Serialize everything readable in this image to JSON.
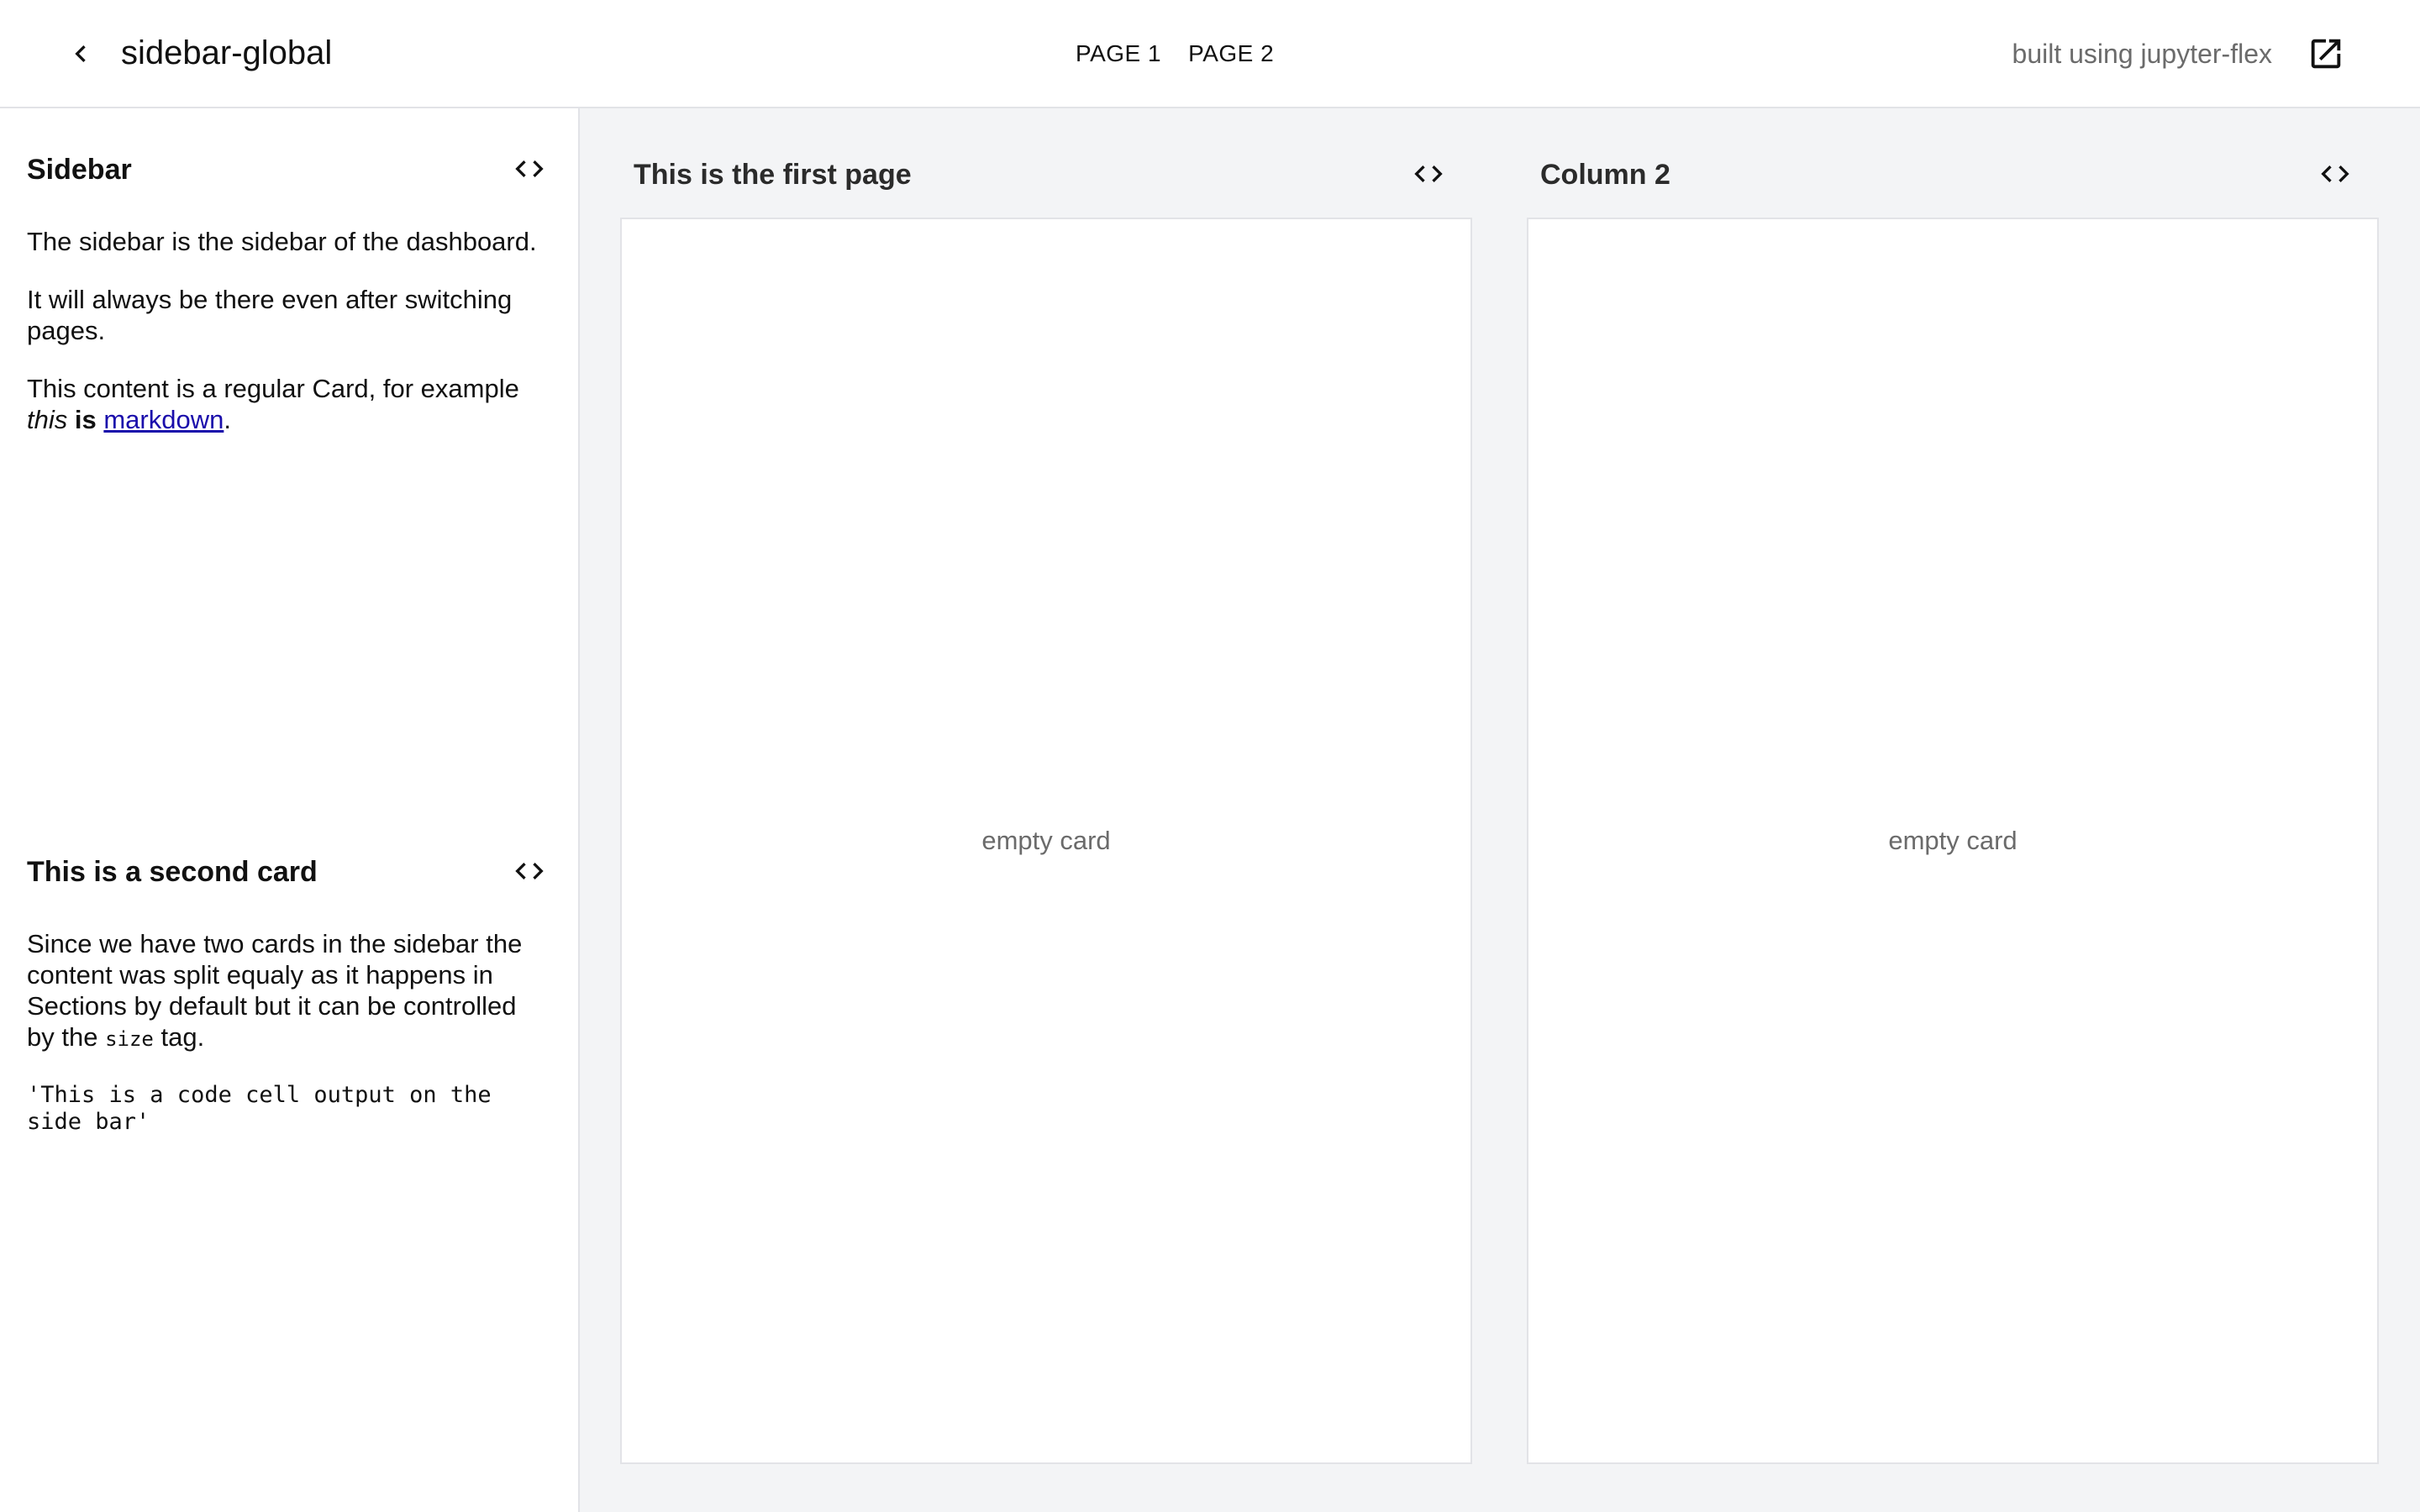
{
  "header": {
    "title": "sidebar-global",
    "nav": [
      "PAGE 1",
      "PAGE 2"
    ],
    "built_using": "built using jupyter-flex"
  },
  "sidebar": {
    "card1": {
      "title": "Sidebar",
      "p1": "The sidebar is the sidebar of the dashboard.",
      "p2": "It will always be there even after switching pages.",
      "p3_prefix": "This content is a regular Card, for example ",
      "p3_em": "this",
      "p3_strong": "is",
      "p3_link": "markdown",
      "p3_suffix": "."
    },
    "card2": {
      "title": "This is a second card",
      "p1_text": "Since we have two cards in the sidebar the content was split equaly as it happens in Sections by default but it can be controlled by the ",
      "p1_code": "size",
      "p1_suffix": " tag.",
      "code_output": "'This is a code cell output on the side bar'"
    }
  },
  "main": {
    "columns": [
      {
        "title": "This is the first page",
        "body": "empty card"
      },
      {
        "title": "Column 2",
        "body": "empty card"
      }
    ]
  },
  "icons": {
    "back": "chevron-left-icon",
    "open": "open-in-new-icon",
    "code": "code-icon"
  },
  "colors": {
    "background": "#f3f4f6",
    "border": "#e2e3e7",
    "muted_text": "#6b6b6b",
    "link": "#1a0dab"
  }
}
